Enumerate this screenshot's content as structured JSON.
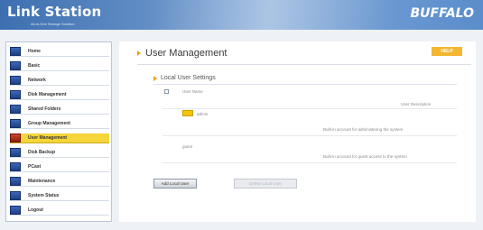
{
  "header": {
    "app_name": "Link Station",
    "app_sub": "All-in-One Storage Solution",
    "brand": "BUFFALO"
  },
  "sidebar": {
    "items": [
      {
        "label": "Home",
        "active": false
      },
      {
        "label": "Basic",
        "active": false
      },
      {
        "label": "Network",
        "active": false
      },
      {
        "label": "Disk Management",
        "active": false
      },
      {
        "label": "Shared Folders",
        "active": false
      },
      {
        "label": "Group Management",
        "active": false
      },
      {
        "label": "User Management",
        "active": true
      },
      {
        "label": "Disk Backup",
        "active": false
      },
      {
        "label": "PCast",
        "active": false
      },
      {
        "label": "Maintenance",
        "active": false
      },
      {
        "label": "System Status",
        "active": false
      },
      {
        "label": "Logout",
        "active": false
      }
    ]
  },
  "main": {
    "title": "User Management",
    "help": "HELP",
    "section_title": "Local User Settings",
    "table": {
      "col_name": "User Name",
      "col_desc": "User Description"
    },
    "users": [
      {
        "name": "admin",
        "description": "Built-in account for administering the system"
      },
      {
        "name": "guest",
        "description": "Built-in account for guest access to the system"
      }
    ],
    "buttons": {
      "add": "Add Local User",
      "delete": "Delete Local User"
    }
  }
}
